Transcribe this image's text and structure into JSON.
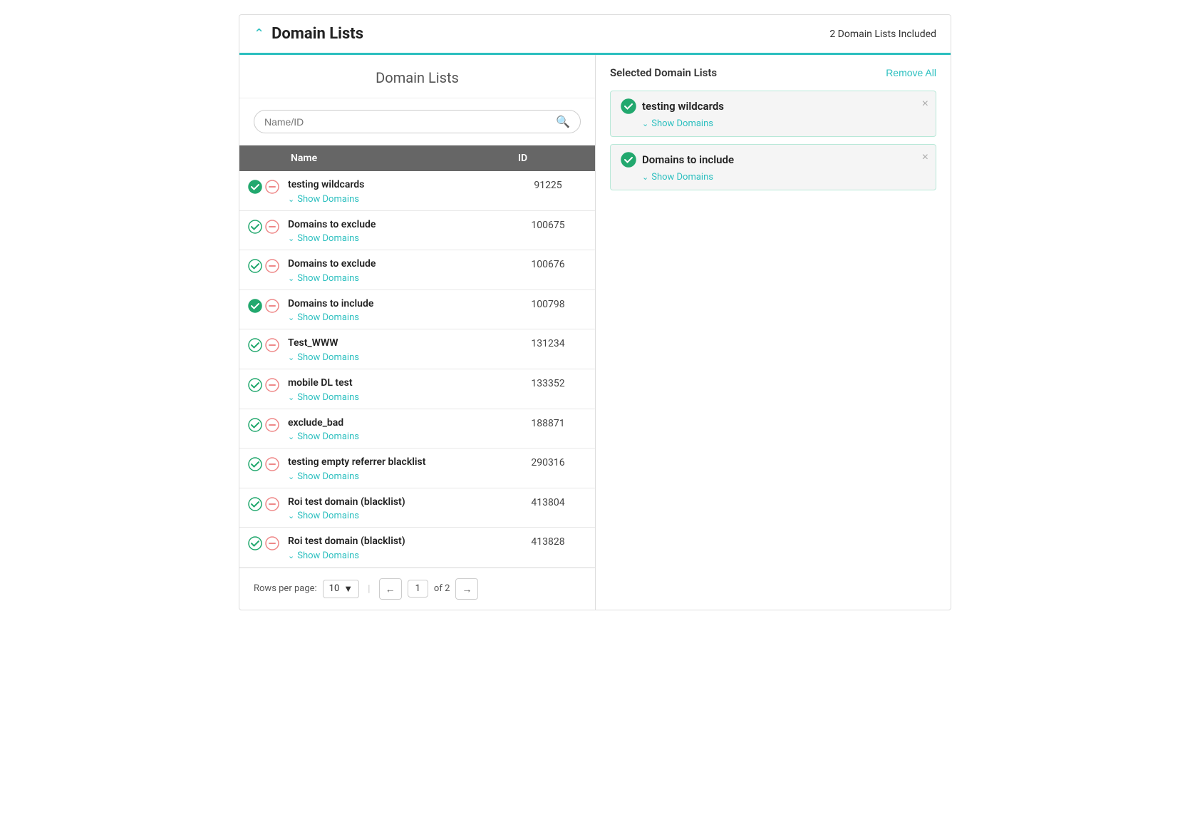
{
  "header": {
    "title": "Domain Lists",
    "count_label": "2 Domain Lists Included",
    "chevron": "^"
  },
  "left_panel": {
    "title": "Domain Lists",
    "search_placeholder": "Name/ID",
    "columns": {
      "name": "Name",
      "id": "ID"
    },
    "rows": [
      {
        "name": "testing wildcards",
        "id": "91225",
        "checked": true,
        "show_domains": "Show Domains"
      },
      {
        "name": "Domains to exclude",
        "id": "100675",
        "checked": false,
        "show_domains": "Show Domains"
      },
      {
        "name": "Domains to exclude",
        "id": "100676",
        "checked": false,
        "show_domains": "Show Domains"
      },
      {
        "name": "Domains to include",
        "id": "100798",
        "checked": true,
        "show_domains": "Show Domains"
      },
      {
        "name": "Test_WWW",
        "id": "131234",
        "checked": false,
        "show_domains": "Show Domains"
      },
      {
        "name": "mobile DL test",
        "id": "133352",
        "checked": false,
        "show_domains": "Show Domains"
      },
      {
        "name": "exclude_bad",
        "id": "188871",
        "checked": false,
        "show_domains": "Show Domains"
      },
      {
        "name": "testing empty referrer blacklist",
        "id": "290316",
        "checked": false,
        "show_domains": "Show Domains"
      },
      {
        "name": "Roi test domain (blacklist)",
        "id": "413804",
        "checked": false,
        "show_domains": "Show Domains"
      },
      {
        "name": "Roi test domain (blacklist)",
        "id": "413828",
        "checked": false,
        "show_domains": "Show Domains"
      }
    ],
    "pagination": {
      "rows_per_page_label": "Rows per page:",
      "rows_per_page_value": "10",
      "current_page": "1",
      "total_pages": "2",
      "of_label": "of 2"
    }
  },
  "right_panel": {
    "title": "Selected Domain Lists",
    "remove_all_label": "Remove All",
    "selected_items": [
      {
        "name": "testing wildcards",
        "show_domains": "Show Domains"
      },
      {
        "name": "Domains to include",
        "show_domains": "Show Domains"
      }
    ]
  },
  "icons": {
    "search": "🔍",
    "chevron_up": "^",
    "chevron_down": "v",
    "close": "×",
    "arrow_left": "←",
    "arrow_right": "→",
    "dropdown_arrow": "▼"
  }
}
